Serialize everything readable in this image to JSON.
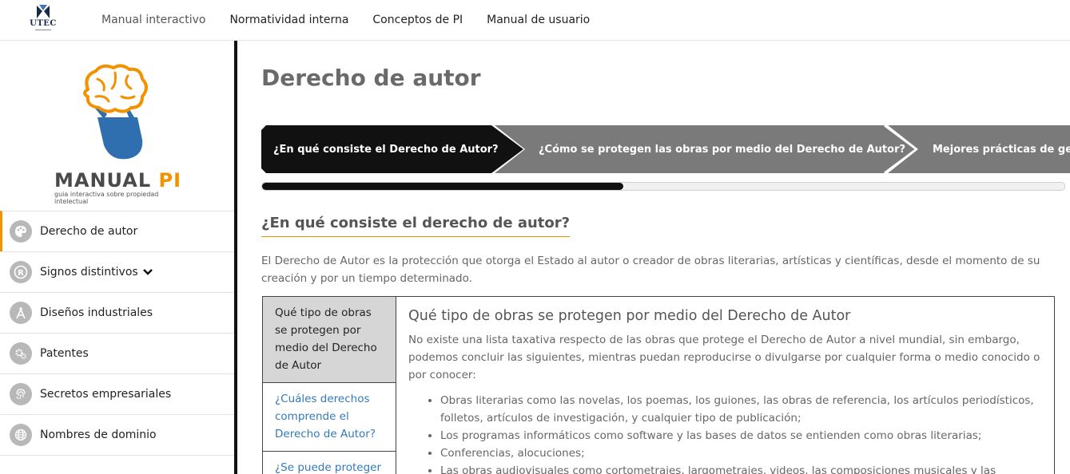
{
  "brand": {
    "short_name": "UTEC"
  },
  "nav": {
    "items": [
      "Manual interactivo",
      "Normatividad interna",
      "Conceptos de PI",
      "Manual de usuario"
    ]
  },
  "logo": {
    "title_a": "MANUAL",
    "title_b": "PI",
    "subtitle": "guia interactiva sobre propiedad intelectual"
  },
  "sidebar": {
    "items": [
      {
        "label": "Derecho de autor",
        "icon": "palette-icon",
        "active": true
      },
      {
        "label": "Signos distintivos",
        "icon": "registered-icon",
        "chevron": "chevron-down-icon"
      },
      {
        "label": "Diseños industriales",
        "icon": "compass-icon"
      },
      {
        "label": "Patentes",
        "icon": "gears-icon"
      },
      {
        "label": "Secretos empresariales",
        "icon": "fingerprint-icon"
      },
      {
        "label": "Nombres de dominio",
        "icon": "globe-icon"
      }
    ]
  },
  "main": {
    "title": "Derecho de autor",
    "steps": [
      "¿En qué consiste el Derecho de Autor?",
      "¿Cómo se protegen las obras por medio del Derecho de Autor?",
      "Mejores prácticas de gestión"
    ],
    "progress_percent": 45,
    "section_title": "¿En qué consiste el derecho de autor?",
    "intro": "El Derecho de Autor es la protección que otorga el Estado al autor o creador de obras literarias, artísticas y científicas, desde el momento de su creación y por un tiempo determinado.",
    "vtabs": [
      "Qué tipo de obras se protegen por medio del Derecho de Autor",
      "¿Cuáles derechos comprende el Derecho de Autor?",
      "¿Se puede proteger"
    ],
    "tab_content": {
      "title": "Qué tipo de obras se protegen por medio del Derecho de Autor",
      "text": "No existe una lista taxativa respecto de las obras que protege el Derecho de Autor a nivel mundial, sin embargo, podemos concluir las siguientes, mientras puedan reproducirse o divulgarse por cualquier forma o medio conocido o por conocer:",
      "list": [
        "Obras literarias como las novelas, los poemas, los guiones, las obras de referencia, los artículos periodísticos, folletos, artículos de investigación, y cualquier tipo de publicación;",
        "Los programas informáticos como software y las bases de datos se entienden como obras literarias;",
        "Conferencias, alocuciones;",
        "Las obras audiovisuales como cortometrajes, largometrajes, videos, las composiciones musicales y las coreografías;"
      ]
    }
  },
  "colors": {
    "accent": "#f39200",
    "step_active": "#111111",
    "step_inactive": "#7a7a7a",
    "link": "#337ab7"
  }
}
